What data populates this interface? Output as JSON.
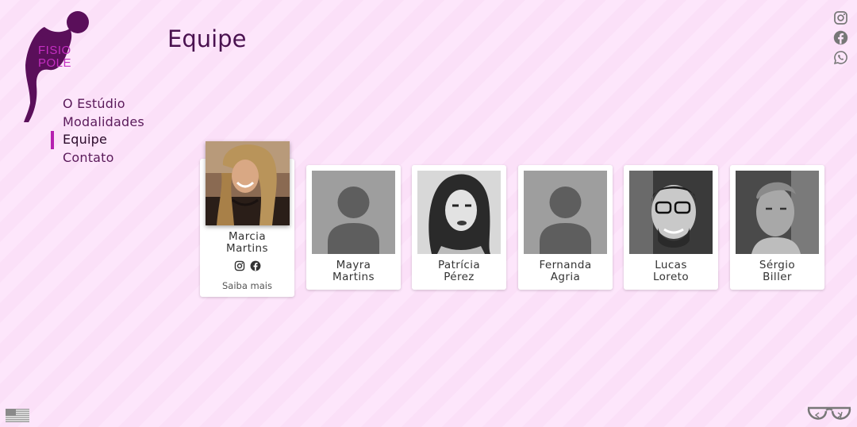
{
  "logo": {
    "text_line1": "FISIO",
    "text_line2": "POLE"
  },
  "nav": {
    "items": [
      {
        "label": "O Estúdio",
        "active": false
      },
      {
        "label": "Modalidades",
        "active": false
      },
      {
        "label": "Equipe",
        "active": true
      },
      {
        "label": "Contato",
        "active": false
      }
    ]
  },
  "page": {
    "title": "Equipe"
  },
  "header_social": {
    "icons": [
      "instagram-icon",
      "facebook-icon",
      "whatsapp-icon"
    ]
  },
  "team": [
    {
      "first": "Marcia",
      "last": "Martins",
      "photo": "photo",
      "featured": true,
      "more_label": "Saiba mais"
    },
    {
      "first": "Mayra",
      "last": "Martins",
      "photo": "placeholder"
    },
    {
      "first": "Patrícia",
      "last": "Pérez",
      "photo": "photo"
    },
    {
      "first": "Fernanda",
      "last": "Agria",
      "photo": "placeholder"
    },
    {
      "first": "Lucas",
      "last": "Loreto",
      "photo": "photo"
    },
    {
      "first": "Sérgio",
      "last": "Biller",
      "photo": "photo"
    }
  ],
  "footer": {
    "language_icon": "us-flag-icon",
    "dev_icon": "glasses-code-icon"
  },
  "colors": {
    "accent": "#b51fb0",
    "logo": "#5a0f5a",
    "logo_text": "#c42fc2",
    "placeholder": "#9e9e9e"
  }
}
